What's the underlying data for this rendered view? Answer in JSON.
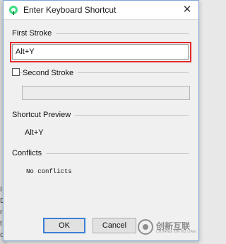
{
  "background": {
    "fragments": [
      "I",
      "D,",
      "ri",
      "t",
      "o"
    ]
  },
  "dialog": {
    "title": "Enter Keyboard Shortcut",
    "close_glyph": "✕",
    "first_stroke": {
      "heading": "First Stroke",
      "value": "Alt+Y"
    },
    "second_stroke": {
      "label": "Second Stroke",
      "checked": false,
      "value": ""
    },
    "shortcut_preview": {
      "heading": "Shortcut Preview",
      "value": "Alt+Y"
    },
    "conflicts": {
      "heading": "Conflicts",
      "value": "No conflicts"
    },
    "buttons": {
      "ok": "OK",
      "cancel": "Cancel"
    }
  },
  "watermark": {
    "text": "创新互联",
    "subtext": "CHUANG XIN HU LIAN"
  },
  "colors": {
    "highlight_frame": "#e32b2b",
    "dialog_border": "#7fa6d8",
    "app_icon": "#3ddc84"
  },
  "icons": {
    "app": "android-studio-icon",
    "close": "close-icon",
    "watermark": "watermark-logo-icon"
  }
}
